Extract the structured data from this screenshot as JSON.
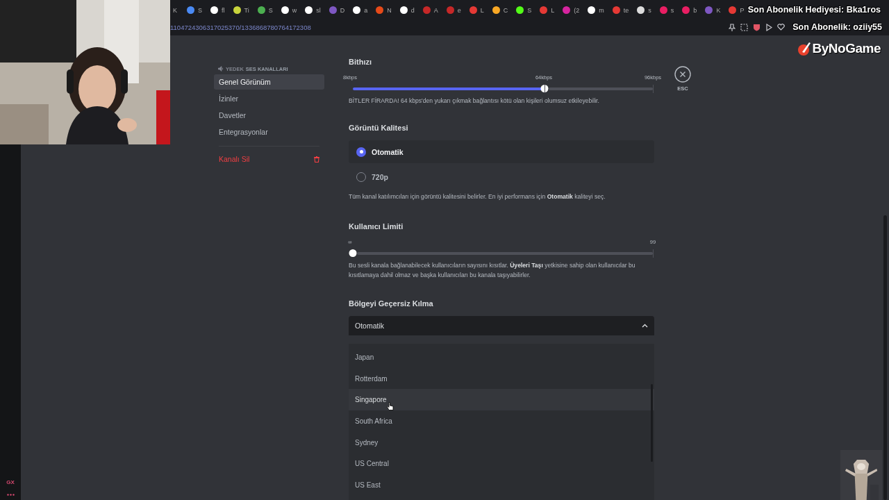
{
  "browser": {
    "tabs": [
      {
        "label": "K"
      },
      {
        "label": "S",
        "color": "#4a8af4"
      },
      {
        "label": "fl",
        "color": "#ffffff"
      },
      {
        "label": "Ti",
        "color": "#c8d43c"
      },
      {
        "label": "S",
        "color": "#4caf50"
      },
      {
        "label": "w",
        "color": "#ffffff"
      },
      {
        "label": "sl",
        "color": "#ffffff"
      },
      {
        "label": "D",
        "color": "#7e57c2"
      },
      {
        "label": "a",
        "color": "#ffffff"
      },
      {
        "label": "N",
        "color": "#e64a19"
      },
      {
        "label": "d",
        "color": "#ffffff"
      },
      {
        "label": "A",
        "color": "#c62828"
      },
      {
        "label": "e",
        "color": "#c62828"
      },
      {
        "label": "L",
        "color": "#e53935"
      },
      {
        "label": "C",
        "color": "#f9a825"
      },
      {
        "label": "S",
        "color": "#53fc18"
      },
      {
        "label": "L",
        "color": "#e53935"
      },
      {
        "label": "(2",
        "color": "#d6249f"
      },
      {
        "label": "m",
        "color": "#ffffff"
      },
      {
        "label": "te",
        "color": "#e53935"
      },
      {
        "label": "s",
        "color": "#dddddd"
      },
      {
        "label": "s",
        "color": "#e91e63"
      },
      {
        "label": "b",
        "color": "#e91e63"
      },
      {
        "label": "K",
        "color": "#7e57c2"
      },
      {
        "label": "P",
        "color": "#e53935"
      }
    ],
    "address": "1104724306317025370/1336868780764172308"
  },
  "overlay": {
    "gift_line": "Son Abonelik Hediyesi: Bka1ros",
    "sub_line": "Son Abonelik: oziiy55",
    "logo": "ByNoGame"
  },
  "rail": {
    "logo": "GX"
  },
  "sidebar": {
    "header_prefix": "YEDEK",
    "header": "SES KANALLARI",
    "items": [
      {
        "label": "Genel Görünüm",
        "selected": true
      },
      {
        "label": "İzinler",
        "selected": false
      },
      {
        "label": "Davetler",
        "selected": false
      },
      {
        "label": "Entegrasyonlar",
        "selected": false
      }
    ],
    "delete_label": "Kanalı Sil"
  },
  "close": {
    "label": "ESC"
  },
  "bitrate": {
    "title": "Bithızı",
    "marks": [
      "8kbps",
      "64kbps",
      "96kbps"
    ],
    "level": 0.64,
    "description": "BİTLER FİRARDA! 64 kbps'den yukarı çıkmak bağlantısı kötü olan kişileri olumsuz etkileyebilir."
  },
  "video_quality": {
    "title": "Görüntü Kalitesi",
    "options": [
      {
        "label": "Otomatik",
        "selected": true
      },
      {
        "label": "720p",
        "selected": false
      }
    ],
    "description": "Tüm kanal katılımcıları için görüntü kalitesini belirler. En iyi performans için **Otomatik** kaliteyi seç."
  },
  "user_limit": {
    "title": "Kullanıcı Limiti",
    "marks": [
      "∞",
      "99"
    ],
    "level": 0,
    "description": "Bu sesli kanala bağlanabilecek kullanıcıların sayısını kısıtlar. **Üyeleri Taşı** yetkisine sahip olan kullanıcılar bu kısıtlamaya dahil olmaz ve başka kullanıcıları bu kanala taşıyabilirler."
  },
  "region_override": {
    "title": "Bölgeyi Geçersiz Kılma",
    "value": "Otomatik",
    "expanded": true,
    "options": [
      {
        "label": "Japan",
        "hovered": false
      },
      {
        "label": "Rotterdam",
        "hovered": false
      },
      {
        "label": "Singapore",
        "hovered": true
      },
      {
        "label": "South Africa",
        "hovered": false
      },
      {
        "label": "Sydney",
        "hovered": false
      },
      {
        "label": "US Central",
        "hovered": false
      },
      {
        "label": "US East",
        "hovered": false
      }
    ]
  }
}
